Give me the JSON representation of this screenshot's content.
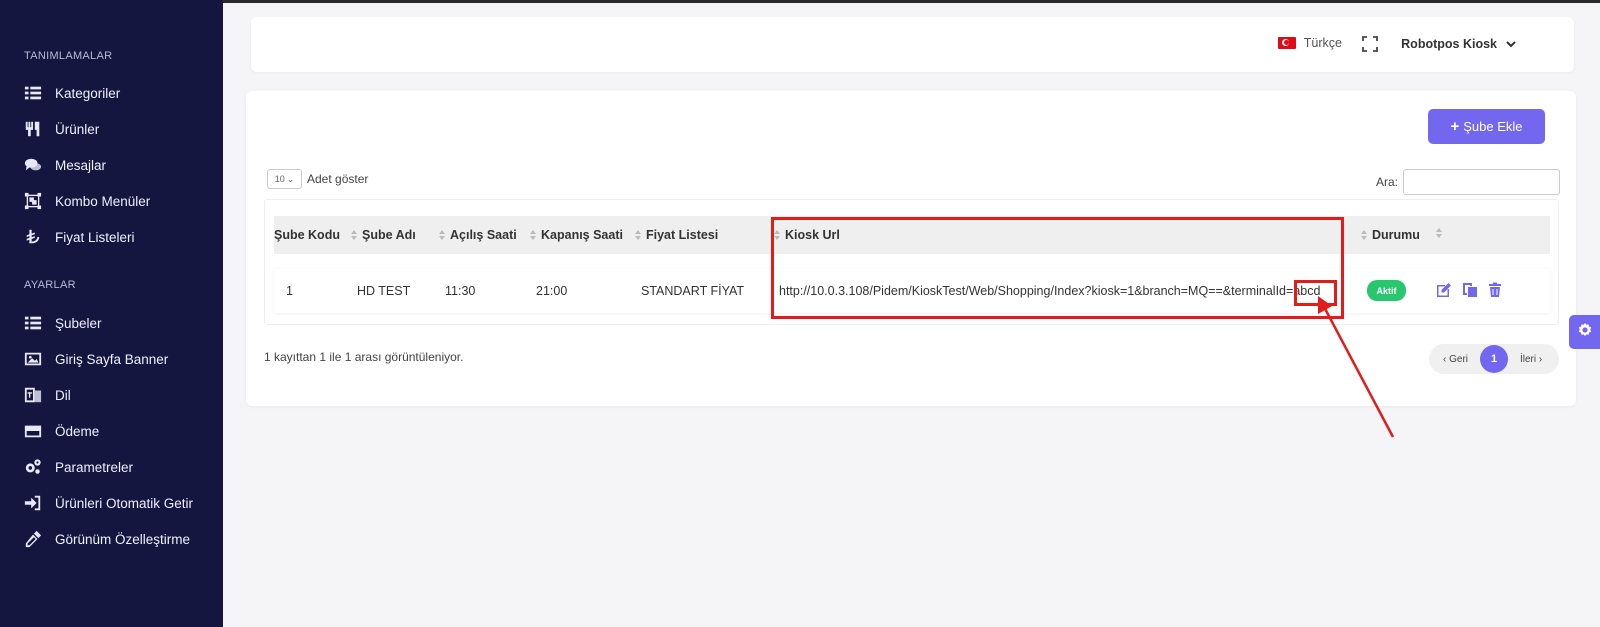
{
  "sidebar": {
    "section1_title": "TANIMLAMALAR",
    "section1_items": [
      {
        "label": "Kategoriler",
        "icon": "list-icon"
      },
      {
        "label": "Ürünler",
        "icon": "utensils-icon"
      },
      {
        "label": "Mesajlar",
        "icon": "comments-icon"
      },
      {
        "label": "Kombo Menüler",
        "icon": "object-group-icon"
      },
      {
        "label": "Fiyat Listeleri",
        "icon": "lira-icon"
      }
    ],
    "section2_title": "AYARLAR",
    "section2_items": [
      {
        "label": "Şubeler",
        "icon": "list-icon"
      },
      {
        "label": "Giriş Sayfa Banner",
        "icon": "image-icon"
      },
      {
        "label": "Dil",
        "icon": "language-icon"
      },
      {
        "label": "Ödeme",
        "icon": "credit-card-icon"
      },
      {
        "label": "Parametreler",
        "icon": "cogs-icon"
      },
      {
        "label": "Ürünleri Otomatik Getir",
        "icon": "sign-in-icon"
      },
      {
        "label": "Görünüm Özelleştirme",
        "icon": "eyedropper-icon"
      }
    ]
  },
  "header": {
    "language": "Türkçe",
    "user_name": "Robotpos Kiosk"
  },
  "toolbar": {
    "add_button_label": "Şube Ekle",
    "page_length_value": "10",
    "page_length_label": "Adet göster",
    "search_label": "Ara:",
    "search_value": ""
  },
  "table": {
    "headers": [
      "Şube Kodu",
      "Şube Adı",
      "Açılış Saati",
      "Kapanış Saati",
      "Fiyat Listesi",
      "Kiosk Url",
      "Durumu",
      ""
    ],
    "rows": [
      {
        "code": "1",
        "name": "HD TEST",
        "open": "11:30",
        "close": "21:00",
        "price_list": "STANDART FİYAT",
        "kiosk_url": "http://10.0.3.108/Pidem/KioskTest/Web/Shopping/Index?kiosk=1&branch=MQ==&terminalId=abcd",
        "status": "Aktif"
      }
    ]
  },
  "footer": {
    "info": "1 kayıttan 1 ile 1 arası görüntüleniyor.",
    "prev_label": "Geri",
    "current_page": "1",
    "next_label": "İleri"
  },
  "colors": {
    "sidebar_bg": "#141640",
    "accent": "#7367f0",
    "success": "#28c76f",
    "annotation": "#e31b1b"
  }
}
